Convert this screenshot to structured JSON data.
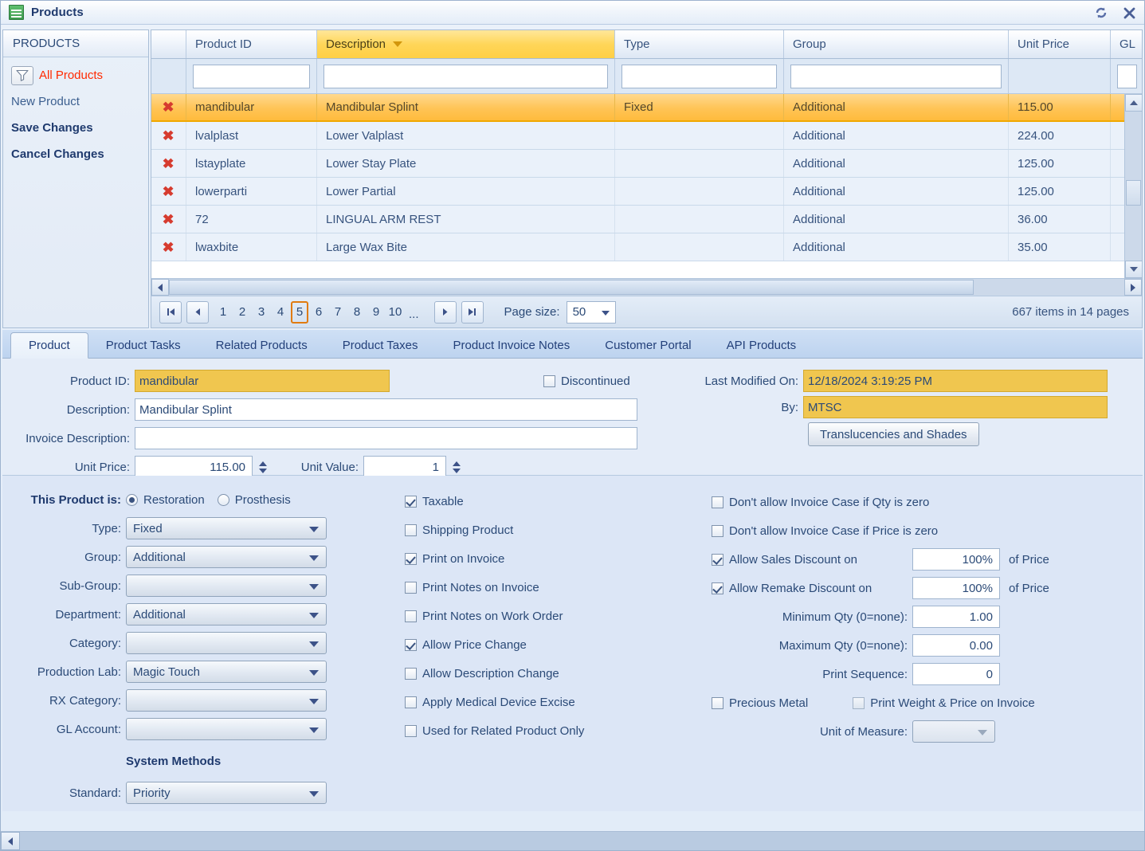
{
  "window": {
    "title": "Products",
    "icon": "document-list-icon",
    "refresh_icon": "refresh-icon",
    "close_icon": "close-icon"
  },
  "sidebar": {
    "header": "PRODUCTS",
    "filter_icon": "funnel-icon",
    "items": [
      {
        "label": "All Products",
        "style": "red"
      },
      {
        "label": "New Product",
        "style": "plain"
      },
      {
        "label": "Save Changes",
        "style": "bold"
      },
      {
        "label": "Cancel Changes",
        "style": "bold"
      }
    ]
  },
  "grid": {
    "columns": [
      {
        "key": "x",
        "label": ""
      },
      {
        "key": "id",
        "label": "Product ID"
      },
      {
        "key": "desc",
        "label": "Description",
        "sorted": true,
        "sort_dir": "desc"
      },
      {
        "key": "type",
        "label": "Type"
      },
      {
        "key": "group",
        "label": "Group"
      },
      {
        "key": "price",
        "label": "Unit Price"
      },
      {
        "key": "gl",
        "label": "GL"
      }
    ],
    "filters": {
      "id": "",
      "desc": "",
      "type": "",
      "group": "",
      "price": "",
      "gl": ""
    },
    "rows": [
      {
        "id": "mandibular",
        "desc": "Mandibular Splint",
        "type": "Fixed",
        "group": "Additional",
        "price": "115.00",
        "selected": true
      },
      {
        "id": "lvalplast",
        "desc": "Lower Valplast",
        "type": "",
        "group": "Additional",
        "price": "224.00",
        "selected": false
      },
      {
        "id": "lstayplate",
        "desc": "Lower Stay Plate",
        "type": "",
        "group": "Additional",
        "price": "125.00",
        "selected": false
      },
      {
        "id": "lowerparti",
        "desc": "Lower Partial",
        "type": "",
        "group": "Additional",
        "price": "125.00",
        "selected": false
      },
      {
        "id": "72",
        "desc": "LINGUAL ARM REST",
        "type": "",
        "group": "Additional",
        "price": "36.00",
        "selected": false
      },
      {
        "id": "lwaxbite",
        "desc": "Large Wax Bite",
        "type": "",
        "group": "Additional",
        "price": "35.00",
        "selected": false
      }
    ]
  },
  "pager": {
    "first_icon": "first-page-icon",
    "prev_icon": "prev-page-icon",
    "next_icon": "next-page-icon",
    "last_icon": "last-page-icon",
    "pages": [
      "1",
      "2",
      "3",
      "4",
      "5",
      "6",
      "7",
      "8",
      "9",
      "10"
    ],
    "current_page": "5",
    "ellipsis": "...",
    "page_size_label": "Page size:",
    "page_size_value": "50",
    "items_count": "667 items in 14 pages"
  },
  "tabs": [
    {
      "label": "Product",
      "active": true
    },
    {
      "label": "Product Tasks",
      "active": false
    },
    {
      "label": "Related Products",
      "active": false
    },
    {
      "label": "Product Taxes",
      "active": false
    },
    {
      "label": "Product Invoice Notes",
      "active": false
    },
    {
      "label": "Customer Portal",
      "active": false
    },
    {
      "label": "API Products",
      "active": false
    }
  ],
  "form_top": {
    "product_id_label": "Product ID:",
    "product_id_value": "mandibular",
    "description_label": "Description:",
    "description_value": "Mandibular Splint",
    "invoice_description_label": "Invoice Description:",
    "invoice_description_value": "",
    "unit_price_label": "Unit Price:",
    "unit_price_value": "115.00",
    "unit_value_label": "Unit Value:",
    "unit_value_value": "1",
    "discontinued_label": "Discontinued",
    "discontinued_checked": false,
    "last_modified_label": "Last Modified On:",
    "last_modified_value": "12/18/2024 3:19:25 PM",
    "by_label": "By:",
    "by_value": "MTSC",
    "translucencies_button": "Translucencies and Shades"
  },
  "form_bottom": {
    "product_is_label": "This Product is:",
    "restoration_label": "Restoration",
    "restoration_selected": true,
    "prosthesis_label": "Prosthesis",
    "prosthesis_selected": false,
    "dropdowns": [
      {
        "label": "Type:",
        "value": "Fixed",
        "disabled": false
      },
      {
        "label": "Group:",
        "value": "Additional",
        "disabled": false
      },
      {
        "label": "Sub-Group:",
        "value": "",
        "disabled": false
      },
      {
        "label": "Department:",
        "value": "Additional",
        "disabled": false
      },
      {
        "label": "Category:",
        "value": "",
        "disabled": false
      },
      {
        "label": "Production Lab:",
        "value": "Magic Touch",
        "disabled": false
      },
      {
        "label": "RX Category:",
        "value": "",
        "disabled": false
      },
      {
        "label": "GL Account:",
        "value": "",
        "disabled": false
      }
    ],
    "system_methods_title": "System Methods",
    "standard_label": "Standard:",
    "standard_value": "Priority",
    "checkboxes_mid": [
      {
        "label": "Taxable",
        "checked": true
      },
      {
        "label": "Shipping Product",
        "checked": false
      },
      {
        "label": "Print on Invoice",
        "checked": true
      },
      {
        "label": "Print Notes on Invoice",
        "checked": false
      },
      {
        "label": "Print Notes on Work Order",
        "checked": false
      },
      {
        "label": "Allow Price Change",
        "checked": true
      },
      {
        "label": "Allow Description Change",
        "checked": false
      },
      {
        "label": "Apply Medical Device Excise",
        "checked": false
      },
      {
        "label": "Used for Related Product Only",
        "checked": false
      }
    ],
    "right": {
      "no_invoice_qty_zero_label": "Don't allow Invoice Case if Qty is zero",
      "no_invoice_qty_zero_checked": false,
      "no_invoice_price_zero_label": "Don't allow Invoice Case if Price is zero",
      "no_invoice_price_zero_checked": false,
      "sales_discount_label": "Allow Sales Discount on",
      "sales_discount_checked": true,
      "sales_discount_value": "100%",
      "sales_discount_suffix": "of Price",
      "remake_discount_label": "Allow Remake Discount on",
      "remake_discount_checked": true,
      "remake_discount_value": "100%",
      "remake_discount_suffix": "of Price",
      "min_qty_label": "Minimum Qty (0=none):",
      "min_qty_value": "1.00",
      "max_qty_label": "Maximum Qty (0=none):",
      "max_qty_value": "0.00",
      "print_sequence_label": "Print Sequence:",
      "print_sequence_value": "0",
      "precious_metal_label": "Precious Metal",
      "precious_metal_checked": false,
      "print_weight_label": "Print Weight & Price on Invoice",
      "print_weight_checked": false,
      "unit_of_measure_label": "Unit of Measure:",
      "unit_of_measure_value": ""
    }
  }
}
